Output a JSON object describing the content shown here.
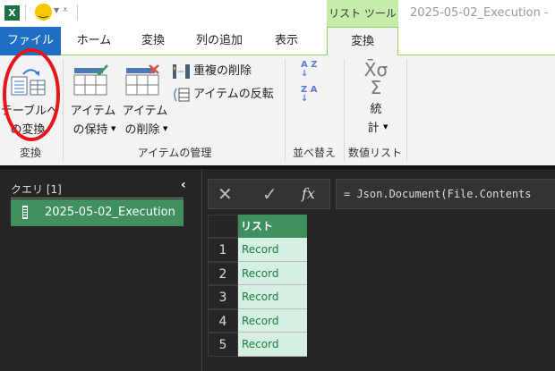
{
  "title_bar": {
    "context_tab": "リスト ツール",
    "window_title": "2025-05-02_Execution -"
  },
  "tabs": {
    "file": "ファイル",
    "home": "ホーム",
    "transform": "変換",
    "add_column": "列の追加",
    "view": "表示",
    "list_transform": "変換"
  },
  "ribbon": {
    "convert_group": {
      "button_line1": "テーブルへ",
      "button_line2": "の変換",
      "label": "変換"
    },
    "manage_group": {
      "keep_line1": "アイテム",
      "keep_line2": "の保持",
      "remove_line1": "アイテム",
      "remove_line2": "の削除",
      "remove_duplicates": "重複の削除",
      "reverse_items": "アイテムの反転",
      "label": "アイテムの管理"
    },
    "sort_group": {
      "label": "並べ替え",
      "asc": "A Z",
      "desc": "Z A"
    },
    "numeric_group": {
      "stats_line1": "統",
      "stats_line2": "計",
      "label": "数値リスト",
      "symbol": "X̄σ",
      "sigma": "Σ"
    }
  },
  "queries": {
    "header": "クエリ [1]",
    "items": [
      "2025-05-02_Execution"
    ]
  },
  "formula_bar": {
    "cancel": "✕",
    "commit": "✓",
    "fx": "fx",
    "formula": "= Json.Document(File.Contents"
  },
  "table": {
    "header": "リスト",
    "rows": [
      {
        "n": "1",
        "v": "Record"
      },
      {
        "n": "2",
        "v": "Record"
      },
      {
        "n": "3",
        "v": "Record"
      },
      {
        "n": "4",
        "v": "Record"
      },
      {
        "n": "5",
        "v": "Record"
      }
    ]
  },
  "colors": {
    "accent_green": "#3f8f5f",
    "file_blue": "#1f6fc5",
    "cell_bg": "#d5efe0",
    "annotation_red": "#e8141c"
  }
}
